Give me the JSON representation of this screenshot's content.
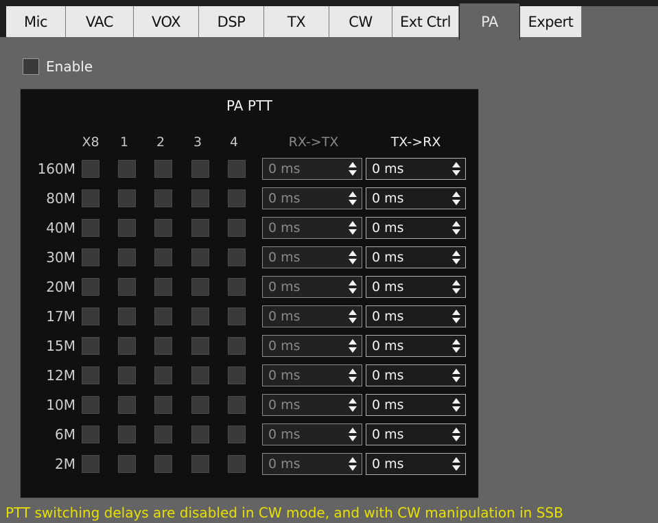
{
  "tabs": [
    {
      "label": "Mic",
      "active": false
    },
    {
      "label": "VAC",
      "active": false
    },
    {
      "label": "VOX",
      "active": false
    },
    {
      "label": "DSP",
      "active": false
    },
    {
      "label": "TX",
      "active": false
    },
    {
      "label": "CW",
      "active": false
    },
    {
      "label": "Ext Ctrl",
      "active": false
    },
    {
      "label": "PA",
      "active": true
    },
    {
      "label": "Expert",
      "active": false
    }
  ],
  "enable": {
    "label": "Enable",
    "checked": false
  },
  "panel": {
    "title": "PA PTT",
    "columns": [
      "X8",
      "1",
      "2",
      "3",
      "4"
    ],
    "rx_tx_header": "RX->TX",
    "tx_rx_header": "TX->RX",
    "rows": [
      {
        "band": "160M",
        "rx_tx": "0 ms",
        "tx_rx": "0 ms"
      },
      {
        "band": "80M",
        "rx_tx": "0 ms",
        "tx_rx": "0 ms"
      },
      {
        "band": "40M",
        "rx_tx": "0 ms",
        "tx_rx": "0 ms"
      },
      {
        "band": "30M",
        "rx_tx": "0 ms",
        "tx_rx": "0 ms"
      },
      {
        "band": "20M",
        "rx_tx": "0 ms",
        "tx_rx": "0 ms"
      },
      {
        "band": "17M",
        "rx_tx": "0 ms",
        "tx_rx": "0 ms"
      },
      {
        "band": "15M",
        "rx_tx": "0 ms",
        "tx_rx": "0 ms"
      },
      {
        "band": "12M",
        "rx_tx": "0 ms",
        "tx_rx": "0 ms"
      },
      {
        "band": "10M",
        "rx_tx": "0 ms",
        "tx_rx": "0 ms"
      },
      {
        "band": "6M",
        "rx_tx": "0 ms",
        "tx_rx": "0 ms"
      },
      {
        "band": "2M",
        "rx_tx": "0 ms",
        "tx_rx": "0 ms"
      }
    ]
  },
  "note": "PTT switching delays are disabled in CW mode, and with CW manipulation in SSB",
  "colors": {
    "background": "#646464",
    "panel": "#101010",
    "note": "#e7e100"
  }
}
